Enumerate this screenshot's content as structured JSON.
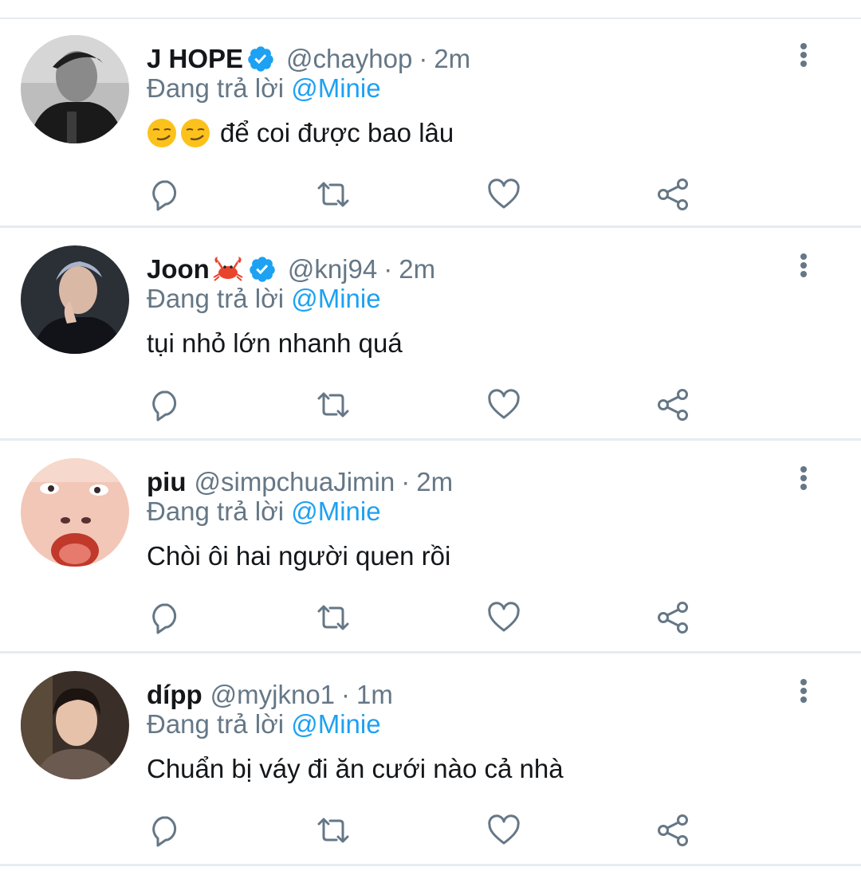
{
  "colors": {
    "link": "#1da1f2",
    "muted": "#657786",
    "verified": "#1da1f2",
    "divider": "#e6ecf0"
  },
  "tweets": [
    {
      "name": "J HOPE",
      "verified": true,
      "handle": "@chayhop",
      "separator": "·",
      "time": "2m",
      "replying_prefix": "Đang trả lời",
      "replying_to": "@Minie",
      "emoji": [
        "smirking-face",
        "smirking-face"
      ],
      "text": "để coi được bao lâu",
      "avatar": "avatar-jhope"
    },
    {
      "name": "Joon",
      "name_emoji": "crab",
      "verified": true,
      "handle": "@knj94",
      "separator": "·",
      "time": "2m",
      "replying_prefix": "Đang trả lời",
      "replying_to": "@Minie",
      "text": "tụi nhỏ lớn nhanh quá",
      "avatar": "avatar-joon"
    },
    {
      "name": "piu",
      "verified": false,
      "handle": "@simpchuaJimin",
      "separator": "·",
      "time": "2m",
      "replying_prefix": "Đang trả lời",
      "replying_to": "@Minie",
      "text": "Chòi ôi hai người quen rồi",
      "avatar": "avatar-piu"
    },
    {
      "name": "dípp",
      "verified": false,
      "handle": "@myjkno1",
      "separator": "·",
      "time": "1m",
      "replying_prefix": "Đang trả lời",
      "replying_to": "@Minie",
      "text": "Chuẩn bị váy đi ăn cưới nào cả nhà",
      "avatar": "avatar-dipp"
    }
  ],
  "icons": {
    "reply": "reply-icon",
    "retweet": "retweet-icon",
    "like": "heart-icon",
    "share": "share-icon",
    "more": "more-vertical-icon"
  }
}
